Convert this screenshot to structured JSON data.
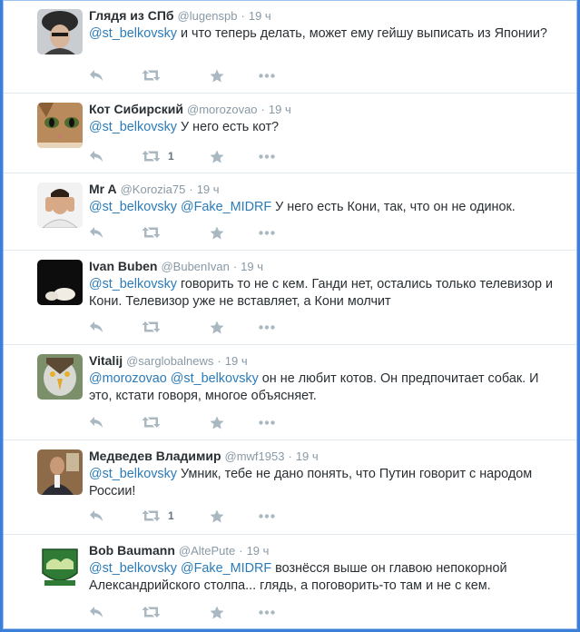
{
  "tweets": [
    {
      "name": "Глядя из СПб",
      "handle": "@lugenspb",
      "time": "19 ч",
      "parts": [
        {
          "t": "@st_belkovsky",
          "m": true
        },
        {
          "t": " и что теперь делать, может ему гейшу выписать из Японии?",
          "m": false
        }
      ],
      "retweet_count": "",
      "avatar": "man-in-fur-hat-avatar"
    },
    {
      "name": "Кот Сибирский",
      "handle": "@morozovao",
      "time": "19 ч",
      "parts": [
        {
          "t": "@st_belkovsky",
          "m": true
        },
        {
          "t": " У него есть кот?",
          "m": false
        }
      ],
      "retweet_count": "1",
      "avatar": "cat-face-avatar"
    },
    {
      "name": "Mr A",
      "handle": "@Korozia75",
      "time": "19 ч",
      "parts": [
        {
          "t": "@st_belkovsky",
          "m": true
        },
        {
          "t": " ",
          "m": false
        },
        {
          "t": "@Fake_MIDRF",
          "m": true
        },
        {
          "t": " У него есть Кони, так, что он не одинок.",
          "m": false
        }
      ],
      "retweet_count": "",
      "avatar": "man-covering-ears-avatar"
    },
    {
      "name": "Ivan Buben",
      "handle": "@BubenIvan",
      "time": "19 ч",
      "parts": [
        {
          "t": "@st_belkovsky",
          "m": true
        },
        {
          "t": " говорить то не с кем. Ганди нет, остались только телевизор и Кони. Телевизор уже не вставляет, а Кони молчит",
          "m": false
        }
      ],
      "retweet_count": "",
      "avatar": "dark-photo-avatar"
    },
    {
      "name": "Vitalij",
      "handle": "@sarglobalnews",
      "time": "19 ч",
      "parts": [
        {
          "t": "@morozovao",
          "m": true
        },
        {
          "t": " ",
          "m": false
        },
        {
          "t": "@st_belkovsky",
          "m": true
        },
        {
          "t": " он не любит котов. Он предпочитает собак. И это, кстати говоря, многое объясняет.",
          "m": false
        }
      ],
      "retweet_count": "",
      "avatar": "eagle-avatar"
    },
    {
      "name": "Медведев Владимир",
      "handle": "@mwf1953",
      "time": "19 ч",
      "parts": [
        {
          "t": "@st_belkovsky",
          "m": true
        },
        {
          "t": " Умник, тебе не дано понять, что Путин говорит с народом России!",
          "m": false
        }
      ],
      "retweet_count": "1",
      "avatar": "man-at-desk-avatar"
    },
    {
      "name": "Bob Baumann",
      "handle": "@AltePute",
      "time": "19 ч",
      "parts": [
        {
          "t": "@st_belkovsky",
          "m": true
        },
        {
          "t": " ",
          "m": false
        },
        {
          "t": "@Fake_MIDRF",
          "m": true
        },
        {
          "t": " вознёсся выше он главою непокорной Александрийского столпа... глядь, а поговорить-то там и не с кем.",
          "m": false
        }
      ],
      "retweet_count": "",
      "avatar": "green-badge-logo-avatar"
    }
  ],
  "action_icons": [
    "reply-icon",
    "retweet-icon",
    "favorite-icon",
    "more-icon"
  ],
  "colors": {
    "mention": "#2b7bb9",
    "name": "#292f33",
    "meta": "#8899a6",
    "icon": "#aab8c2",
    "frame": "#3b7fd9"
  }
}
